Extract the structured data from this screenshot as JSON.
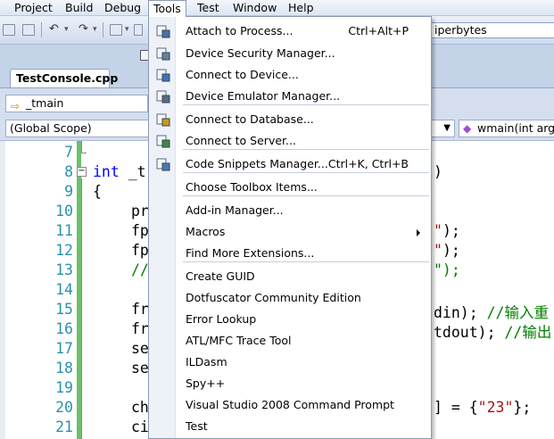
{
  "menubar": {
    "items": [
      {
        "label": "Project"
      },
      {
        "label": "Build"
      },
      {
        "label": "Debug"
      },
      {
        "label": "Tools"
      },
      {
        "label": "Test"
      },
      {
        "label": "Window"
      },
      {
        "label": "Help"
      }
    ]
  },
  "toolbar": {
    "find_value": "iperbytes"
  },
  "document_tab": {
    "label": "TestConsole.cpp"
  },
  "navigation": {
    "function_combo": "_tmain",
    "scope_combo": "(Global Scope)",
    "member_combo": "wmain(int argc,"
  },
  "tools_menu": {
    "items": [
      {
        "label": "Attach to Process...",
        "shortcut": "Ctrl+Alt+P",
        "icon": "attach-process-icon"
      },
      {
        "label": "Device Security Manager...",
        "shortcut": "",
        "icon": "device-security-icon"
      },
      {
        "label": "Connect to Device...",
        "shortcut": "",
        "icon": "connect-device-icon"
      },
      {
        "label": "Device Emulator Manager...",
        "shortcut": "",
        "icon": "device-emulator-icon"
      },
      {
        "label": "Connect to Database...",
        "shortcut": "",
        "icon": "connect-database-icon"
      },
      {
        "label": "Connect to Server...",
        "shortcut": "",
        "icon": "connect-server-icon"
      },
      {
        "label": "Code Snippets Manager...",
        "shortcut": "Ctrl+K, Ctrl+B",
        "icon": "code-snippets-icon"
      },
      {
        "label": "Choose Toolbox Items...",
        "shortcut": "",
        "icon": ""
      },
      {
        "label": "Add-in Manager...",
        "shortcut": "",
        "icon": ""
      },
      {
        "label": "Macros",
        "shortcut": "",
        "icon": "",
        "submenu": true
      },
      {
        "label": "Find More Extensions...",
        "shortcut": "",
        "icon": ""
      },
      {
        "label": "Create GUID",
        "shortcut": "",
        "icon": ""
      },
      {
        "label": "Dotfuscator Community Edition",
        "shortcut": "",
        "icon": ""
      },
      {
        "label": "Error Lookup",
        "shortcut": "",
        "icon": ""
      },
      {
        "label": "ATL/MFC Trace Tool",
        "shortcut": "",
        "icon": ""
      },
      {
        "label": "ILDasm",
        "shortcut": "",
        "icon": ""
      },
      {
        "label": "Spy++",
        "shortcut": "",
        "icon": ""
      },
      {
        "label": "Visual Studio 2008 Command Prompt",
        "shortcut": "",
        "icon": ""
      },
      {
        "label": "Test",
        "shortcut": "",
        "icon": ""
      }
    ]
  },
  "editor": {
    "line_numbers": [
      "7",
      "8",
      "9",
      "10",
      "11",
      "12",
      "13",
      "14",
      "15",
      "16",
      "17",
      "18",
      "19",
      "20",
      "21"
    ],
    "code": {
      "l8_kw": "int",
      "l8_rest": " _t",
      "l8_right": ")",
      "l9": "{",
      "l10": "pr",
      "l11_left": "fp",
      "l11_right_str": "\"",
      "l11_right_rest": ");",
      "l12_left": "fp",
      "l12_right_str": "\"",
      "l12_right_rest": ");",
      "l13_left": "//",
      "l13_right": "\");",
      "l15_left": "fr",
      "l15_right": "din);",
      "l15_comment": " //输入重",
      "l16_left": "fr",
      "l16_right": "tdout);",
      "l16_comment": " //输出",
      "l17": "se",
      "l18": "se",
      "l20_left": "ch",
      "l20_right_pre": "] = {",
      "l20_str": "\"23\"",
      "l20_post": "};",
      "l21": "ci"
    }
  },
  "colors": {
    "accent": "#2b91af",
    "keyword": "#0000ff",
    "string": "#a31515",
    "comment": "#008000"
  }
}
